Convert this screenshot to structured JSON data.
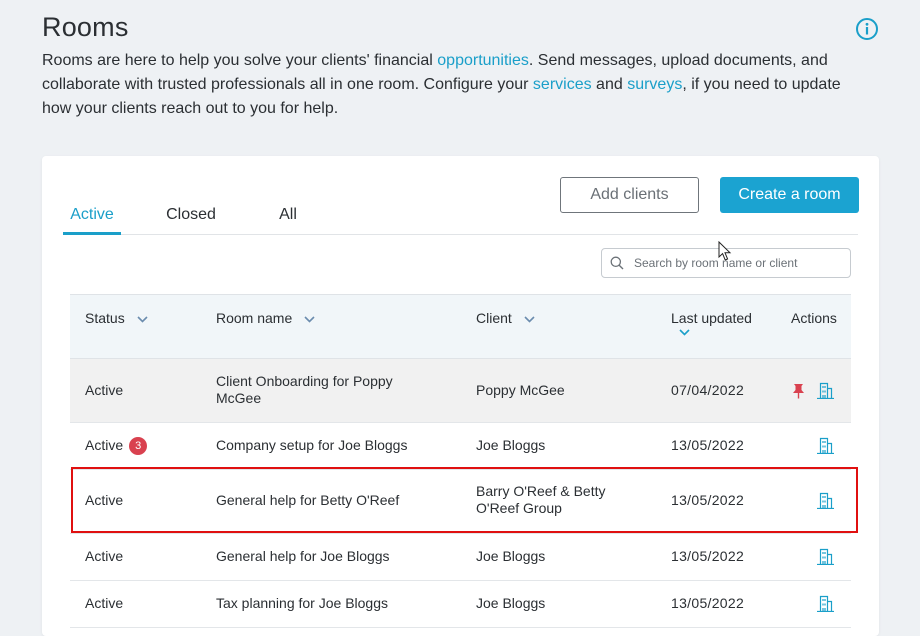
{
  "page": {
    "title": "Rooms",
    "intro_part1": "Rooms are here to help you solve your clients' financial ",
    "intro_link_opportunities": "opportunities",
    "intro_part2": ". Send messages, upload documents, and collaborate with trusted professionals all in one room. Configure your ",
    "intro_link_services": "services",
    "intro_part3": " and ",
    "intro_link_surveys": "surveys",
    "intro_part4": ", if you need to update how your clients reach out to you for help."
  },
  "tabs": [
    "Active",
    "Closed",
    "All"
  ],
  "buttons": {
    "add_clients": "Add clients",
    "create_room": "Create a room"
  },
  "search": {
    "placeholder": "Search by room name or client"
  },
  "table": {
    "headers": {
      "status": "Status",
      "room": "Room name",
      "client": "Client",
      "updated": "Last updated",
      "actions": "Actions"
    },
    "rows": [
      {
        "status": "Active",
        "badge": "",
        "room": "Client Onboarding for Poppy McGee",
        "client": "Poppy McGee",
        "date": "07/04/2022",
        "pinned": true
      },
      {
        "status": "Active",
        "badge": "3",
        "room": "Company setup for Joe Bloggs",
        "client": "Joe Bloggs",
        "date": "13/05/2022",
        "pinned": false
      },
      {
        "status": "Active",
        "badge": "",
        "room": "General help for Betty O'Reef",
        "client": "Barry O'Reef & Betty O'Reef Group",
        "date": "13/05/2022",
        "pinned": false
      },
      {
        "status": "Active",
        "badge": "",
        "room": "General help for Joe Bloggs",
        "client": "Joe Bloggs",
        "date": "13/05/2022",
        "pinned": false
      },
      {
        "status": "Active",
        "badge": "",
        "room": "Tax planning for Joe Bloggs",
        "client": "Joe Bloggs",
        "date": "13/05/2022",
        "pinned": false
      }
    ]
  },
  "colors": {
    "accent": "#1ba3d1",
    "link": "#1a9fc9",
    "badge": "#d9414f",
    "pin": "#d9414f",
    "highlight_box": "#e01010"
  },
  "icons": {
    "info": "info-circle-icon",
    "search": "search-icon",
    "pin": "pin-icon",
    "room": "building-icon",
    "sort": "chevron-down-icon",
    "cursor": "mouse-pointer-icon"
  }
}
